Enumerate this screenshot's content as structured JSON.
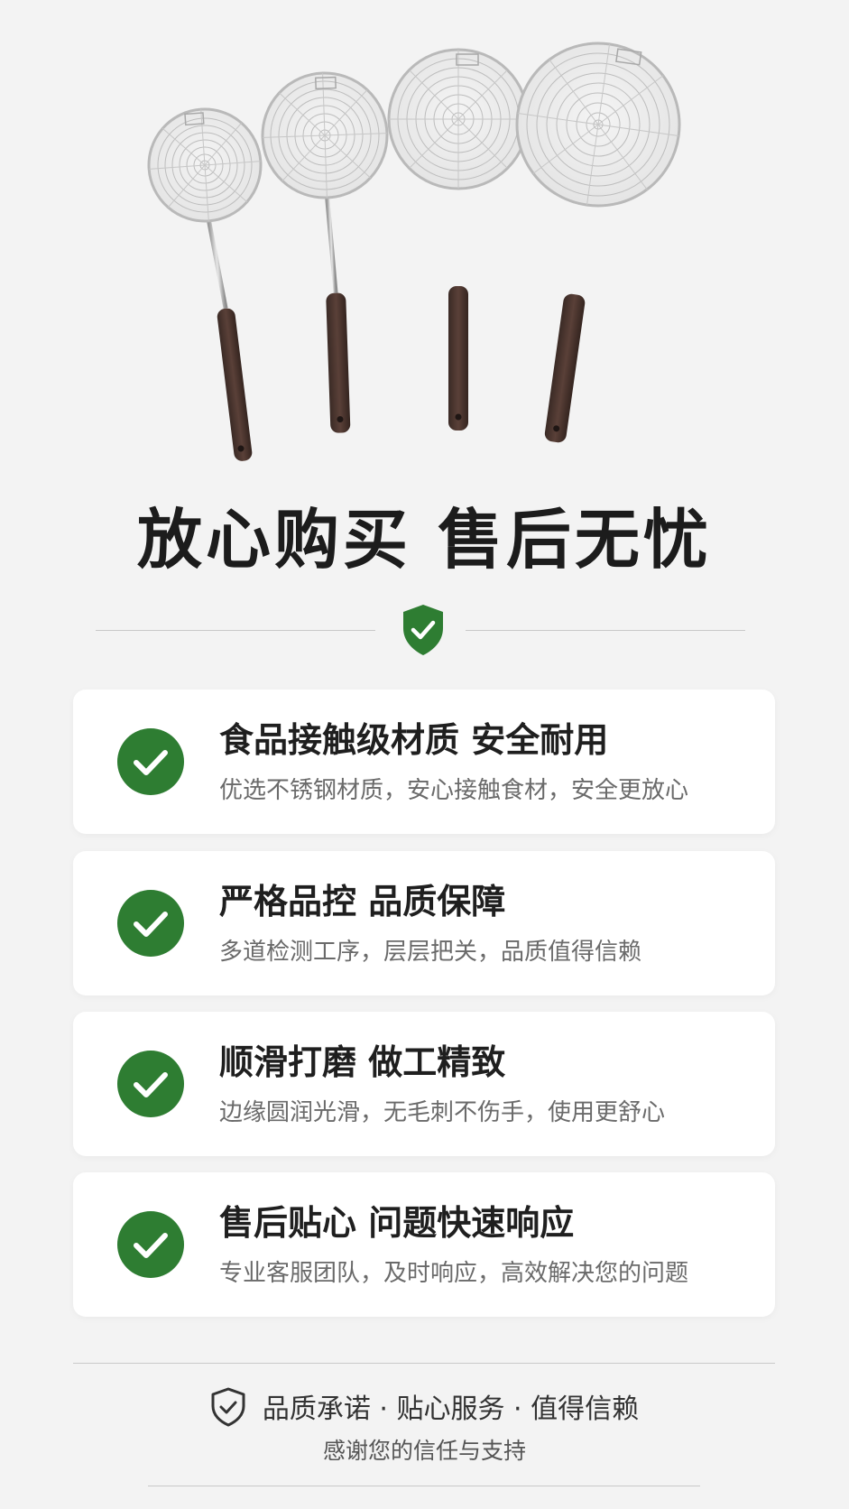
{
  "headline": "放心购买  售后无忧",
  "colors": {
    "accent_green": "#2e7d32",
    "background": "#f3f3f3",
    "card": "#ffffff"
  },
  "divider": {
    "icon": "shield-check-icon"
  },
  "features": [
    {
      "icon": "check-circle-icon",
      "title": "食品接触级材质 安全耐用",
      "desc": "优选不锈钢材质，安心接触食材，安全更放心"
    },
    {
      "icon": "check-circle-icon",
      "title": "严格品控 品质保障",
      "desc": "多道检测工序，层层把关，品质值得信赖"
    },
    {
      "icon": "check-circle-icon",
      "title": "顺滑打磨 做工精致",
      "desc": "边缘圆润光滑，无毛刺不伤手，使用更舒心"
    },
    {
      "icon": "check-circle-icon",
      "title": "售后贴心 问题快速响应",
      "desc": "专业客服团队，及时响应，高效解决您的问题"
    }
  ],
  "footer": {
    "icon": "shield-outline-icon",
    "tagline": "品质承诺 · 贴心服务 · 值得信赖",
    "subline": "感谢您的信任与支持"
  }
}
